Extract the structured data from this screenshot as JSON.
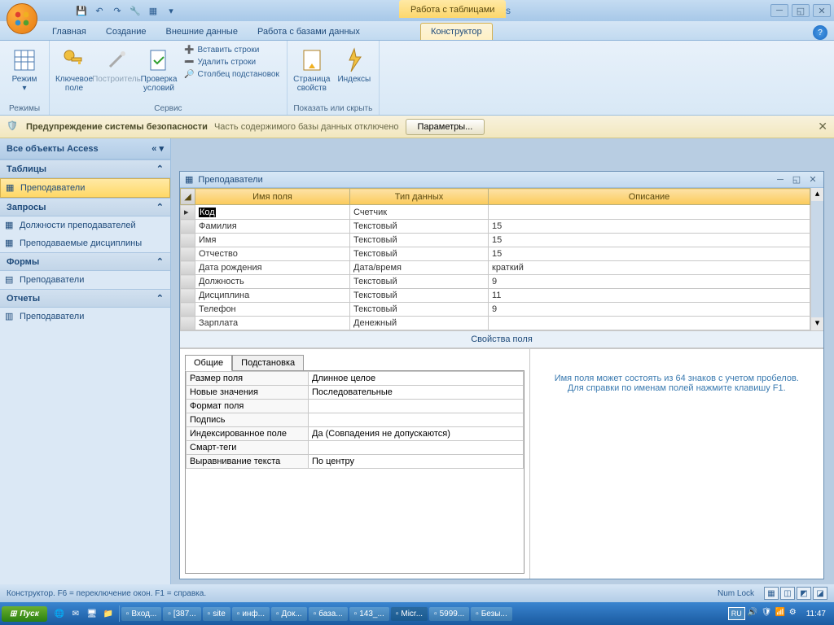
{
  "app_title": "Microsoft Access",
  "table_tools_title": "Работа с таблицами",
  "tabs": {
    "home": "Главная",
    "create": "Создание",
    "external": "Внешние данные",
    "dbtools": "Работа с базами данных",
    "designer": "Конструктор"
  },
  "ribbon": {
    "views_group": "Режимы",
    "view_btn": "Режим",
    "key_btn": "Ключевое поле",
    "builder_btn": "Построитель",
    "validate_btn": "Проверка условий",
    "insert_rows": "Вставить строки",
    "delete_rows": "Удалить строки",
    "lookup_col": "Столбец подстановок",
    "tools_group": "Сервис",
    "prop_sheet": "Страница свойств",
    "indexes": "Индексы",
    "showhide_group": "Показать или скрыть"
  },
  "security": {
    "warn_label": "Предупреждение системы безопасности",
    "warn_text": "Часть содержимого базы данных отключено",
    "params_btn": "Параметры..."
  },
  "nav": {
    "header": "Все объекты Access",
    "tables": "Таблицы",
    "t1": "Преподаватели",
    "queries": "Запросы",
    "q1": "Должности преподавателей",
    "q2": "Преподаваемые дисциплины",
    "forms": "Формы",
    "f1": "Преподаватели",
    "reports": "Отчеты",
    "r1": "Преподаватели"
  },
  "table_window": {
    "title": "Преподаватели",
    "col_name": "Имя поля",
    "col_type": "Тип данных",
    "col_desc": "Описание",
    "rows": [
      {
        "name": "Код",
        "type": "Счетчик",
        "desc": ""
      },
      {
        "name": "Фамилия",
        "type": "Текстовый",
        "desc": "15"
      },
      {
        "name": "Имя",
        "type": "Текстовый",
        "desc": "15"
      },
      {
        "name": "Отчество",
        "type": "Текстовый",
        "desc": "15"
      },
      {
        "name": "Дата рождения",
        "type": "Дата/время",
        "desc": "краткий"
      },
      {
        "name": "Должность",
        "type": "Текстовый",
        "desc": "9"
      },
      {
        "name": "Дисциплина",
        "type": "Текстовый",
        "desc": "11"
      },
      {
        "name": "Телефон",
        "type": "Текстовый",
        "desc": "9"
      },
      {
        "name": "Зарплата",
        "type": "Денежный",
        "desc": ""
      }
    ],
    "props_label": "Свойства поля"
  },
  "props": {
    "tab_general": "Общие",
    "tab_lookup": "Подстановка",
    "rows": [
      {
        "k": "Размер поля",
        "v": "Длинное целое"
      },
      {
        "k": "Новые значения",
        "v": "Последовательные"
      },
      {
        "k": "Формат поля",
        "v": ""
      },
      {
        "k": "Подпись",
        "v": ""
      },
      {
        "k": "Индексированное поле",
        "v": "Да (Совпадения не допускаются)"
      },
      {
        "k": "Смарт-теги",
        "v": ""
      },
      {
        "k": "Выравнивание текста",
        "v": "По центру"
      }
    ],
    "help_text": "Имя поля может состоять из 64 знаков с учетом пробелов.  Для справки по именам полей нажмите клавишу F1."
  },
  "status": {
    "text": "Конструктор.  F6 = переключение окон.  F1 = справка.",
    "numlock": "Num Lock"
  },
  "taskbar": {
    "start": "Пуск",
    "items": [
      "Вход...",
      "[387...",
      "site",
      "инф...",
      "Док...",
      "база...",
      "143_...",
      "Micr...",
      "5999...",
      "Безы..."
    ],
    "lang": "RU",
    "clock": "11:47"
  }
}
